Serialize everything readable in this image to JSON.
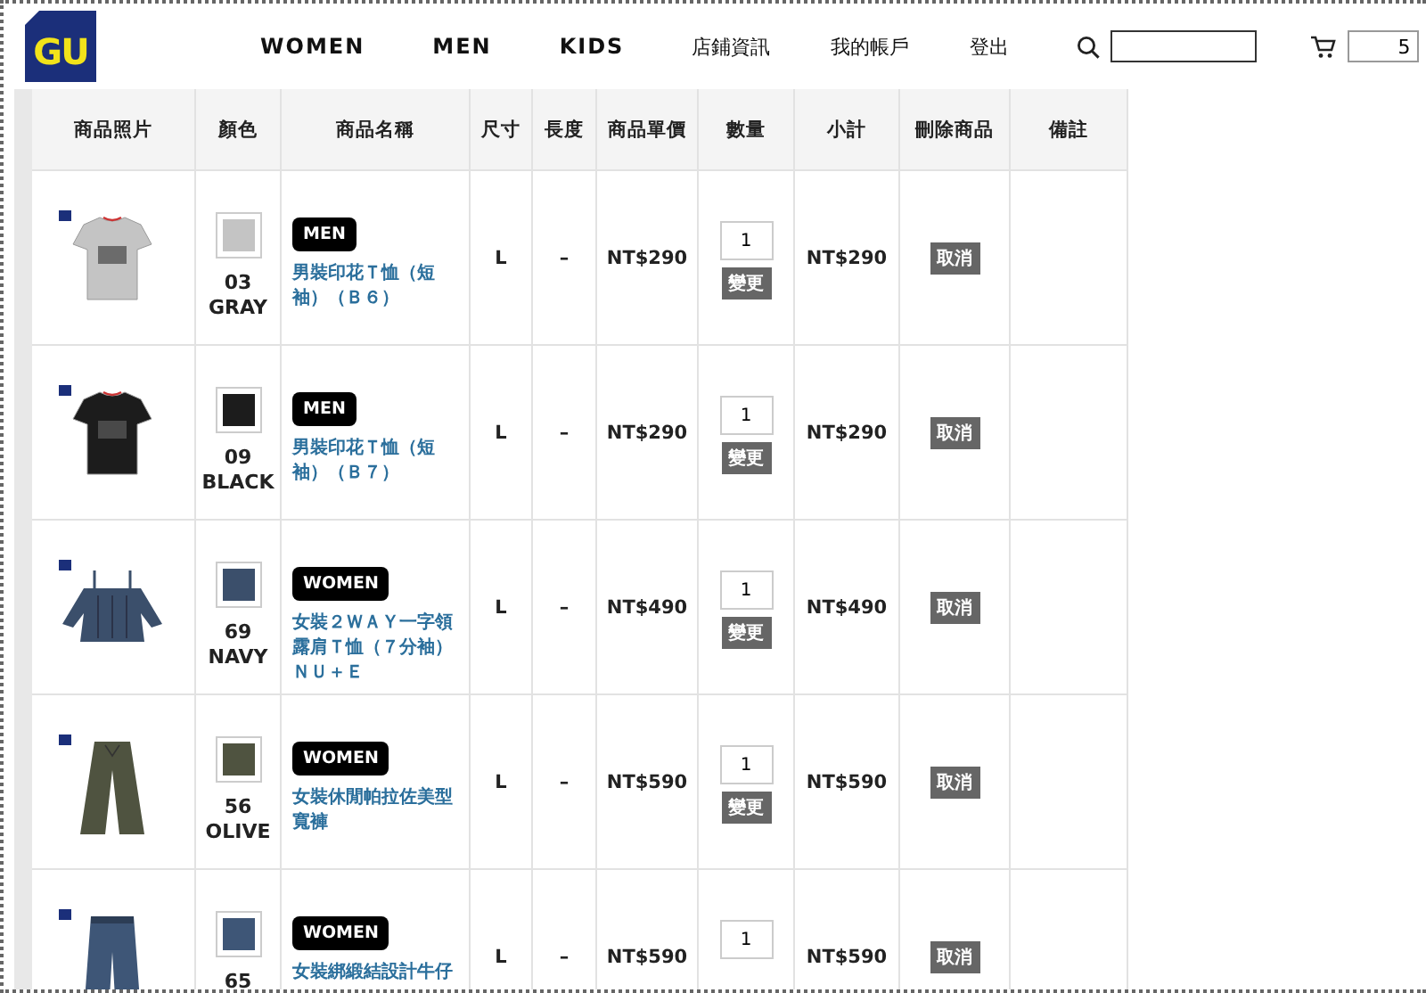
{
  "header": {
    "logo": "GU",
    "nav": [
      {
        "label": "WOMEN",
        "kind": "category"
      },
      {
        "label": "MEN",
        "kind": "category"
      },
      {
        "label": "KIDS",
        "kind": "category"
      },
      {
        "label": "店鋪資訊",
        "kind": "service"
      },
      {
        "label": "我的帳戶",
        "kind": "service"
      },
      {
        "label": "登出",
        "kind": "service"
      }
    ],
    "cart_count": "5"
  },
  "table": {
    "columns": [
      "商品照片",
      "顏色",
      "商品名稱",
      "尺寸",
      "長度",
      "商品單價",
      "數量",
      "小計",
      "刪除商品",
      "備註"
    ],
    "rows": [
      {
        "color": "#c4c4c4",
        "color_code": "03",
        "color_name": "GRAY",
        "category": "MEN",
        "name": "男裝印花Ｔ恤（短袖）（Ｂ６）",
        "size": "L",
        "length": "–",
        "price": "NT$290",
        "quantity": "1",
        "change_button": "變更",
        "subtotal": "NT$290",
        "delete_button": "取消"
      },
      {
        "color": "#1c1c1c",
        "color_code": "09",
        "color_name": "BLACK",
        "category": "MEN",
        "name": "男裝印花Ｔ恤（短袖）（Ｂ７）",
        "size": "L",
        "length": "–",
        "price": "NT$290",
        "quantity": "1",
        "change_button": "變更",
        "subtotal": "NT$290",
        "delete_button": "取消"
      },
      {
        "color": "#3b4f6b",
        "color_code": "69",
        "color_name": "NAVY",
        "category": "WOMEN",
        "name": "女裝２ＷＡＹ一字領露肩Ｔ恤（７分袖）ＮＵ＋Ｅ",
        "size": "L",
        "length": "–",
        "price": "NT$490",
        "quantity": "1",
        "change_button": "變更",
        "subtotal": "NT$490",
        "delete_button": "取消"
      },
      {
        "color": "#4f5340",
        "color_code": "56",
        "color_name": "OLIVE",
        "category": "WOMEN",
        "name": "女裝休閒帕拉佐美型寬褲",
        "size": "L",
        "length": "–",
        "price": "NT$590",
        "quantity": "1",
        "change_button": "變更",
        "subtotal": "NT$590",
        "delete_button": "取消"
      },
      {
        "color": "#3e5677",
        "color_code": "65",
        "category": "WOMEN",
        "name": "女裝綁緞結設計牛仔",
        "size": "L",
        "length": "–",
        "price": "NT$590",
        "quantity": "1",
        "subtotal": "NT$590",
        "delete_button": "取消"
      }
    ]
  }
}
